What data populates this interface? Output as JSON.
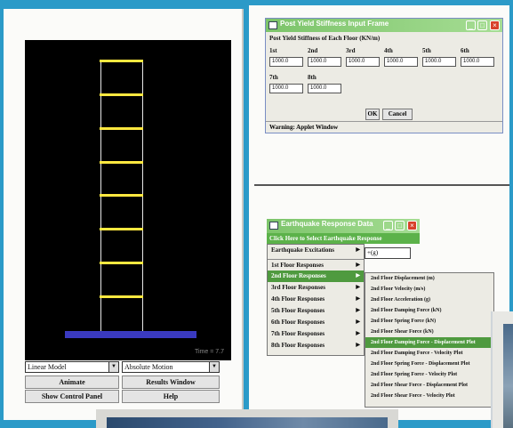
{
  "colors": {
    "background_frame": "#2b9ac8",
    "canvas": "#000000",
    "floor": "#ffe840",
    "base": "#3a3ac0",
    "titlebar": "#7cc46a",
    "menu_highlight": "#4f9a3f"
  },
  "simulation": {
    "floors": 8,
    "time_readout": "Time = 7.7",
    "model_select": "Linear Model",
    "motion_select": "Absolute Motion",
    "buttons": {
      "animate": "Animate",
      "results": "Results Window",
      "show_panel": "Show Control Panel",
      "help": "Help"
    }
  },
  "stiffness_dialog": {
    "title": "Post Yield Stiffness Input Frame",
    "heading": "Post Yield Stiffness of Each Floor (KN/m)",
    "floor_labels": [
      "1st",
      "2nd",
      "3rd",
      "4th",
      "5th",
      "6th",
      "7th",
      "8th"
    ],
    "values": [
      "1000.0",
      "1000.0",
      "1000.0",
      "1000.0",
      "1000.0",
      "1000.0",
      "1000.0",
      "1000.0"
    ],
    "ok_label": "OK",
    "cancel_label": "Cancel",
    "status": "Warning: Applet Window"
  },
  "earthquake_menu": {
    "window_title": "Earthquake Response Data",
    "header": "Click Here to Select Earthquake Response",
    "field_value": "+(g)",
    "items": [
      "Earthquake Excitations",
      "1st Floor Responses",
      "2nd Floor Responses",
      "3rd Floor Responses",
      "4th Floor Responses",
      "5th Floor Responses",
      "6th Floor Responses",
      "7th Floor Responses",
      "8th Floor Responses"
    ],
    "highlighted_index": 2,
    "submenu": [
      "2nd Floor Displacement (m)",
      "2nd Floor Velocity (m/s)",
      "2nd Floor Acceleration (g)",
      "2nd Floor Damping Force (kN)",
      "2nd Floor Spring Force (kN)",
      "2nd Floor Shear Force (kN)",
      "2nd Floor Damping Force - Displacement Plot",
      "2nd Floor Damping Force - Velocity Plot",
      "2nd Floor Spring Force - Displacement Plot",
      "2nd Floor Spring Force - Velocity Plot",
      "2nd Floor Shear Force - Displacement Plot",
      "2nd Floor Shear Force - Velocity Plot"
    ],
    "submenu_highlighted_index": 6
  }
}
